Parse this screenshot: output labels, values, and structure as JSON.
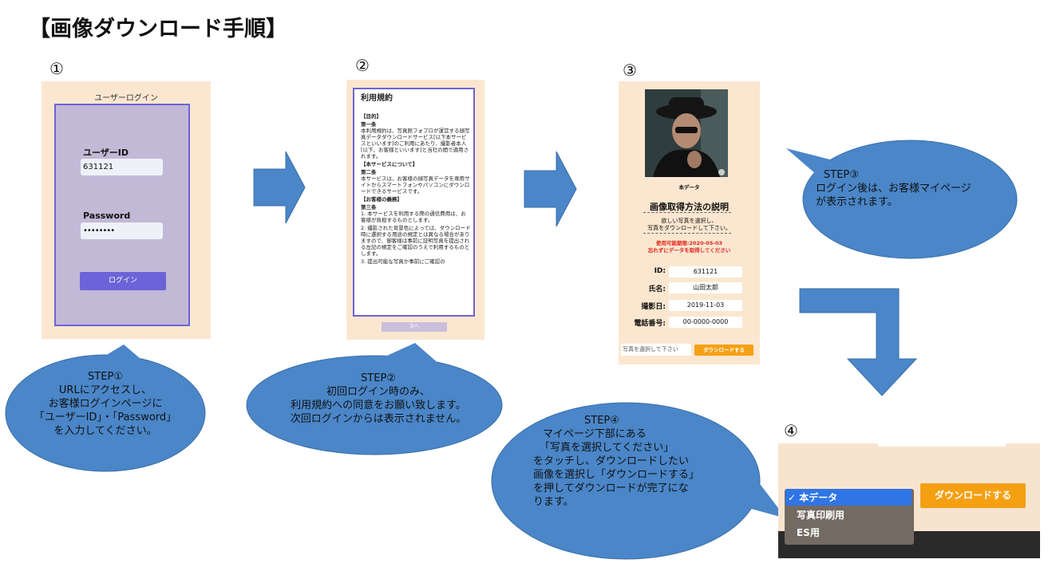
{
  "title": "【画像ダウンロード手順】",
  "steps": {
    "n1": "①",
    "n2": "②",
    "n3": "③",
    "n4": "④"
  },
  "screen1": {
    "header": "ユーザーログイン",
    "userid_label": "ユーザーID",
    "userid_value": "631121",
    "password_label": "Password",
    "password_value": "••••••••",
    "login_button": "ログイン"
  },
  "screen2": {
    "heading": "利用規約",
    "purpose": "【目的】",
    "art1": "第一条",
    "art1_text": "本利用規約は、写真館フォプロが運営する顔写真データダウンロードサービス[以下本サービスといいます]のご利用にあたり、撮影者本人[以下、お客様といいます]と当社の間で適用されます。",
    "service": "【本サービスについて】",
    "art2": "第二条",
    "art2_text": "本サービスは、お客様の顔写真データを専用サイトからスマートフォンやパソコンにダウンロードできるサービスです。",
    "duty": "【お客様の義務】",
    "art3": "第三条",
    "art3_text1": "1. 本サービスを利用する際の通信費用は、お客様が負担するものとします。",
    "art3_text2": "2. 撮影された背景色によっては、ダウンロード時に選択する用途の規定とは異なる場合がありますので、御客様は事前に証明写真を提出される左記の規定をご確認のうえで利用するものとします。",
    "art3_text3": "3. 提出可能な写真か事前にご確認の",
    "next_button": "次へ"
  },
  "screen3": {
    "photo_caption": "本データ",
    "heading": "画像取得方法の説明",
    "desc1": "欲しい写真を選択し、",
    "desc2": "写真をダウンロードして下さい。",
    "expiry": "使用可能期限:2020-05-03",
    "reminder": "忘れずにデータを取得してください",
    "id_label": "ID:",
    "id_value": "631121",
    "name_label": "氏名:",
    "name_value": "山田太郎",
    "date_label": "撮影日:",
    "date_value": "2019-11-03",
    "phone_label": "電話番号:",
    "phone_value": "00-0000-0000",
    "select_placeholder": "写真を選択して下さい",
    "download_button": "ダウンロードする"
  },
  "screen4": {
    "options": [
      "✓ 本データ",
      "写真印刷用",
      "ES用"
    ],
    "download_button": "ダウンロードする"
  },
  "bubbles": {
    "b1": [
      "STEP①",
      "URLにアクセスし、",
      "お客様ログインページに",
      "「ユーザーID」・「Password」",
      "を入力してください。"
    ],
    "b2": [
      "STEP②",
      "初回ログイン時のみ、",
      "利用規約への同意をお願い致します。",
      "次回ログインからは表示されません。"
    ],
    "b3": [
      "STEP③",
      "ログイン後は、お客様マイページ",
      "が表示されます。"
    ],
    "b4": [
      "STEP④",
      "マイページ下部にある",
      "「写真を選択してください」",
      "をタッチし、ダウンロードしたい",
      "画像を選択し「ダウンロードする」",
      "を押してダウンロードが完了にな",
      "ります。"
    ]
  },
  "colors": {
    "bubble": "#4a86c8",
    "accent_purple": "#6c63d8",
    "orange": "#f5a012",
    "screen_bg": "#fbe7d0"
  }
}
